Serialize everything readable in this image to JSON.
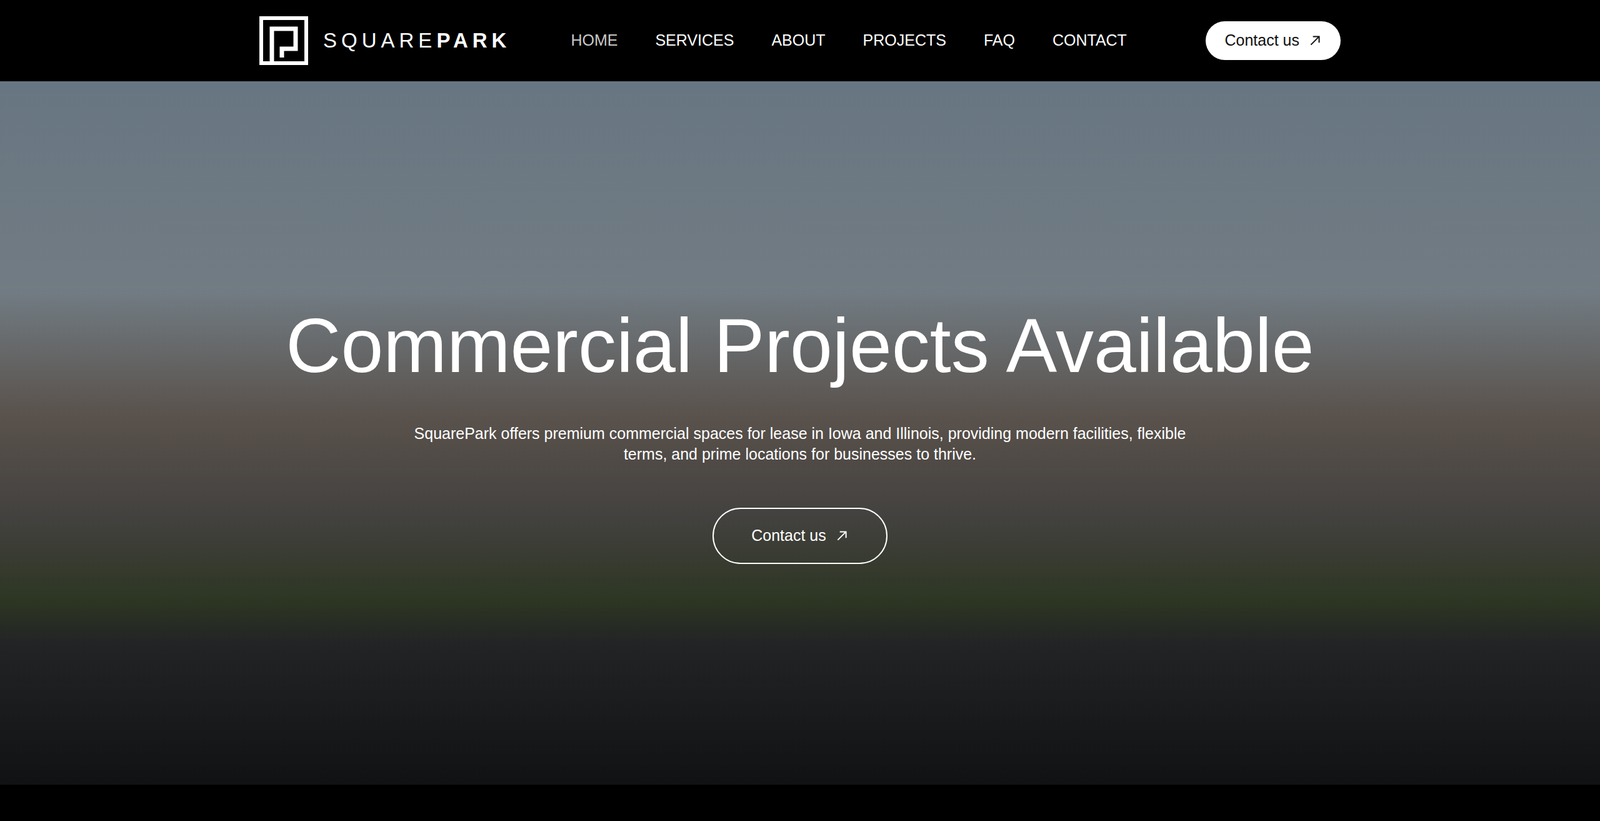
{
  "nav": {
    "logo": {
      "part1": "SQUARE",
      "part2": "PARK"
    },
    "links": [
      {
        "label": "HOME",
        "selected": true
      },
      {
        "label": "SERVICES",
        "selected": false
      },
      {
        "label": "ABOUT",
        "selected": false
      },
      {
        "label": "PROJECTS",
        "selected": false
      },
      {
        "label": "FAQ",
        "selected": false
      },
      {
        "label": "CONTACT",
        "selected": false
      }
    ],
    "cta": "Contact us"
  },
  "hero": {
    "title": "Commercial Projects Available",
    "text": "SquarePark offers premium commercial spaces for lease in Iowa and Illinois, providing modern facilities, flexible terms, and prime locations for businesses to thrive.",
    "button": "Contact us"
  }
}
